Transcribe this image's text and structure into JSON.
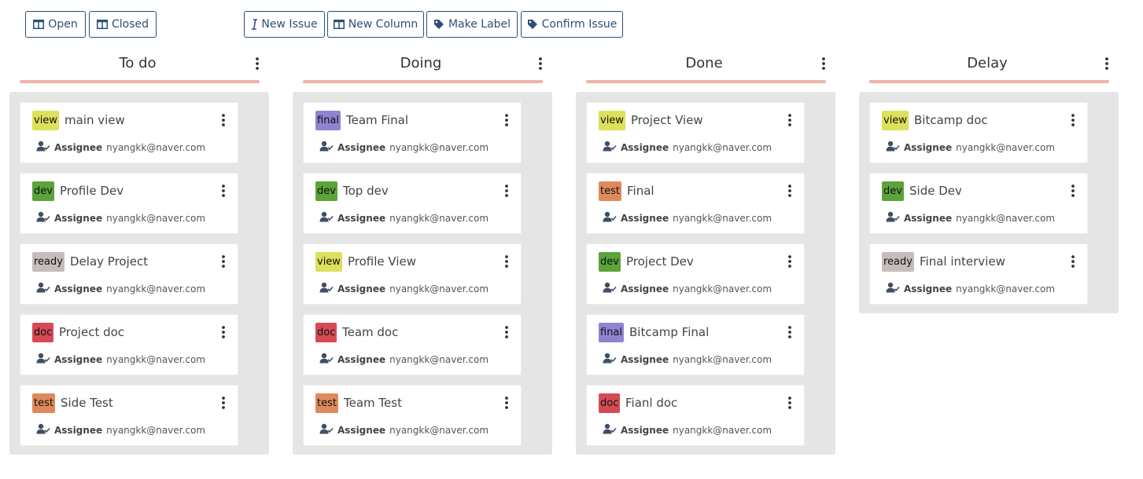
{
  "toolbar": {
    "open": {
      "label": "Open",
      "icon": "columns-icon"
    },
    "closed": {
      "label": "Closed",
      "icon": "columns-icon"
    },
    "new_issue": {
      "label": "New Issue",
      "icon": "text-cursor-icon"
    },
    "new_column": {
      "label": "New Column",
      "icon": "columns-icon"
    },
    "make_label": {
      "label": "Make Label",
      "icon": "tag-icon"
    },
    "confirm_issue": {
      "label": "Confirm Issue",
      "icon": "tag-icon"
    }
  },
  "label_colors": {
    "view": "#dde05a",
    "final": "#9183d2",
    "dev": "#5ba33a",
    "ready": "#c7bcbc",
    "doc": "#d64a55",
    "test": "#e08a5c"
  },
  "columns": [
    {
      "title": "To do",
      "cards": [
        {
          "label": "view",
          "title": "main view",
          "assignee_key": "Assignee",
          "assignee": "nyangkk@naver.com"
        },
        {
          "label": "dev",
          "title": "Profile Dev",
          "assignee_key": "Assignee",
          "assignee": "nyangkk@naver.com"
        },
        {
          "label": "ready",
          "title": "Delay Project",
          "assignee_key": "Assignee",
          "assignee": "nyangkk@naver.com"
        },
        {
          "label": "doc",
          "title": "Project doc",
          "assignee_key": "Assignee",
          "assignee": "nyangkk@naver.com"
        },
        {
          "label": "test",
          "title": "Side Test",
          "assignee_key": "Assignee",
          "assignee": "nyangkk@naver.com"
        }
      ]
    },
    {
      "title": "Doing",
      "cards": [
        {
          "label": "final",
          "title": "Team Final",
          "assignee_key": "Assignee",
          "assignee": "nyangkk@naver.com"
        },
        {
          "label": "dev",
          "title": "Top dev",
          "assignee_key": "Assignee",
          "assignee": "nyangkk@naver.com"
        },
        {
          "label": "view",
          "title": "Profile View",
          "assignee_key": "Assignee",
          "assignee": "nyangkk@naver.com"
        },
        {
          "label": "doc",
          "title": "Team doc",
          "assignee_key": "Assignee",
          "assignee": "nyangkk@naver.com"
        },
        {
          "label": "test",
          "title": "Team Test",
          "assignee_key": "Assignee",
          "assignee": "nyangkk@naver.com"
        }
      ]
    },
    {
      "title": "Done",
      "cards": [
        {
          "label": "view",
          "title": "Project View",
          "assignee_key": "Assignee",
          "assignee": "nyangkk@naver.com"
        },
        {
          "label": "test",
          "title": "Final",
          "assignee_key": "Assignee",
          "assignee": "nyangkk@naver.com"
        },
        {
          "label": "dev",
          "title": "Project Dev",
          "assignee_key": "Assignee",
          "assignee": "nyangkk@naver.com"
        },
        {
          "label": "final",
          "title": "Bitcamp Final",
          "assignee_key": "Assignee",
          "assignee": "nyangkk@naver.com"
        },
        {
          "label": "doc",
          "title": "Fianl doc",
          "assignee_key": "Assignee",
          "assignee": "nyangkk@naver.com"
        }
      ]
    },
    {
      "title": "Delay",
      "cards": [
        {
          "label": "view",
          "title": "Bitcamp doc",
          "assignee_key": "Assignee",
          "assignee": "nyangkk@naver.com"
        },
        {
          "label": "dev",
          "title": "Side Dev",
          "assignee_key": "Assignee",
          "assignee": "nyangkk@naver.com"
        },
        {
          "label": "ready",
          "title": "Final interview",
          "assignee_key": "Assignee",
          "assignee": "nyangkk@naver.com"
        }
      ]
    }
  ],
  "icons": {
    "column_menu": "kebab-menu-icon",
    "card_menu": "kebab-menu-icon",
    "assignee": "user-check-icon"
  }
}
